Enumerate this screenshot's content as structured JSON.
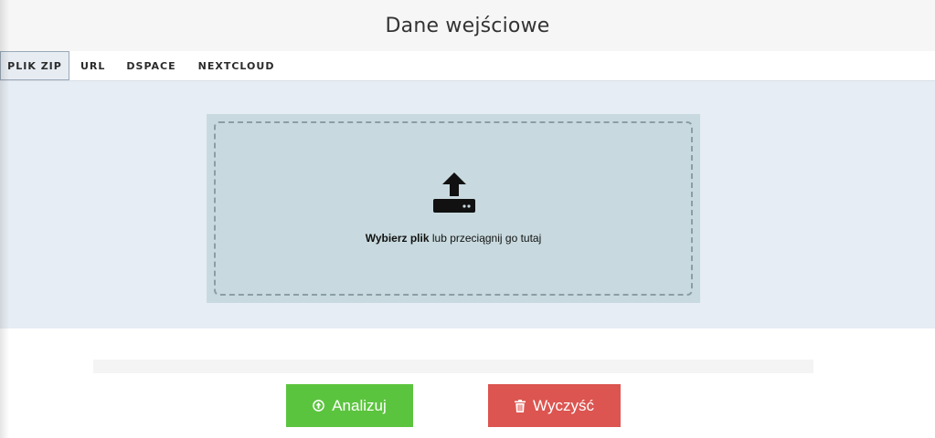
{
  "header": {
    "title": "Dane wejściowe"
  },
  "tabs": [
    {
      "label": "PLIK ZIP",
      "active": true
    },
    {
      "label": "URL",
      "active": false
    },
    {
      "label": "DSPACE",
      "active": false
    },
    {
      "label": "NEXTCLOUD",
      "active": false
    }
  ],
  "dropzone": {
    "icon": "upload-icon",
    "choose_label": "Wybierz plik",
    "drag_label": " lub przeciągnij go tutaj"
  },
  "actions": {
    "analyze_label": "Analizuj",
    "analyze_icon": "arrow-up-circle-icon",
    "clear_label": "Wyczyść",
    "clear_icon": "trash-icon"
  },
  "colors": {
    "analyze": "#5bc43e",
    "clear": "#dc5550",
    "dropzone": "#c8dadf",
    "panel": "#e6edf4"
  }
}
